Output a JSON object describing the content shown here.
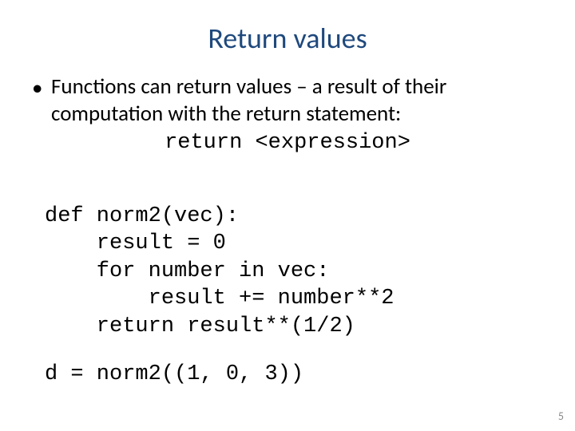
{
  "title": "Return values",
  "bullet": "Functions can return values – a result of their computation with the return statement:",
  "syntax": "return <expression>",
  "code": "def norm2(vec):\n    result = 0\n    for number in vec:\n        result += number**2\n    return result**(1/2)",
  "call": "d = norm2((1, 0, 3))",
  "page": "5"
}
